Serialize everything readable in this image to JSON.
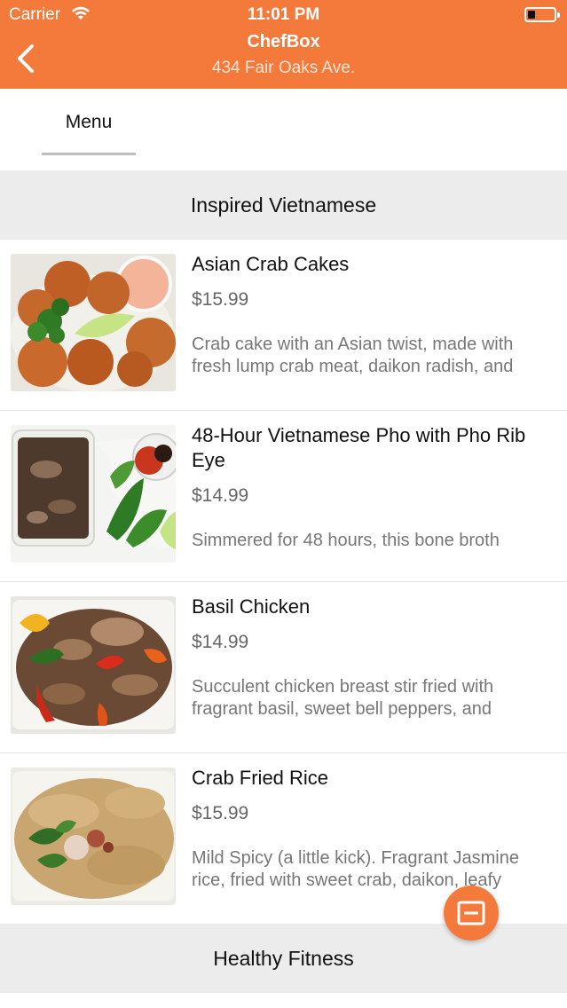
{
  "status_bar": {
    "carrier": "Carrier",
    "time": "11:01 PM"
  },
  "nav": {
    "title": "ChefBox",
    "subtitle": "434 Fair Oaks Ave.",
    "back_icon": "chevron-left-icon"
  },
  "tabs": [
    {
      "label": "Menu",
      "selected": true
    }
  ],
  "sections": [
    {
      "title": "Inspired Vietnamese",
      "items": [
        {
          "name": "Asian Crab Cakes",
          "price": "$15.99",
          "description": "Crab cake with an Asian twist, made with fresh lump crab meat, daikon radish, and"
        },
        {
          "name": "48-Hour Vietnamese Pho with Pho Rib Eye",
          "price": "$14.99",
          "description": "Simmered for 48 hours, this bone broth"
        },
        {
          "name": "Basil Chicken",
          "price": "$14.99",
          "description": "Succulent chicken breast stir fried with fragrant basil, sweet bell peppers, and"
        },
        {
          "name": "Crab Fried Rice",
          "price": "$15.99",
          "description": "Mild Spicy (a little kick). Fragrant Jasmine rice, fried with sweet crab, daikon, leafy"
        }
      ]
    },
    {
      "title": "Healthy Fitness",
      "items": []
    }
  ],
  "fab_icon": "cart-icon",
  "colors": {
    "accent": "#f47a3c",
    "section_bg": "#ececec",
    "price_text": "#666666",
    "desc_text": "#777777"
  }
}
